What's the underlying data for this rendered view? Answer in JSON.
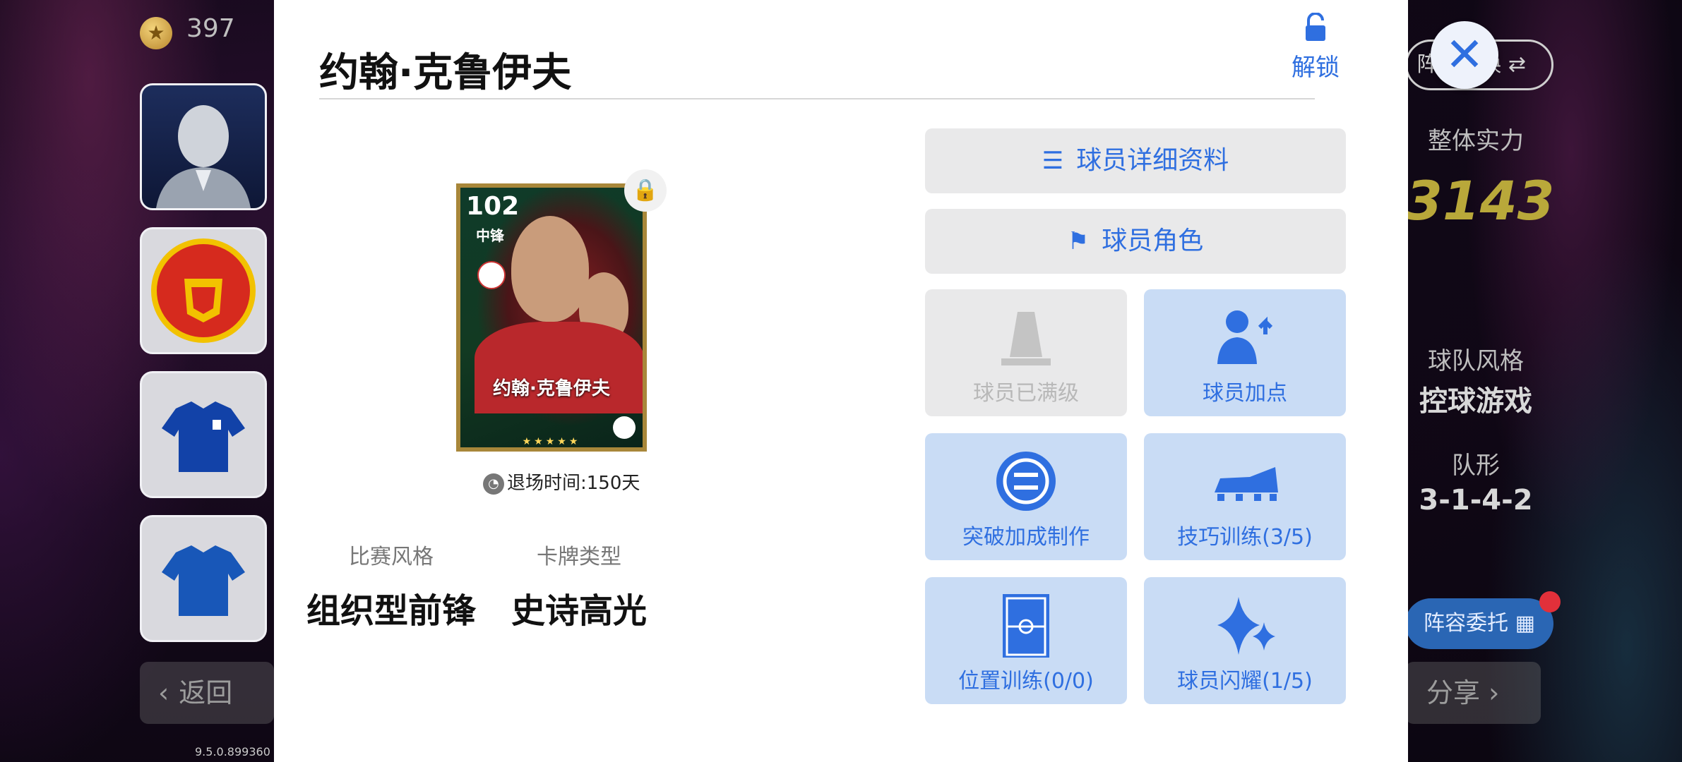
{
  "background": {
    "coins": "397",
    "back_label": "返回",
    "version": "9.5.0.899360",
    "switch_label": "阵型切换",
    "overall_label": "整体实力",
    "overall_value": "3143",
    "style_label": "球队风格",
    "style_value": "控球游戏",
    "formation_label": "队形",
    "formation_value": "3-1-4-2",
    "delegate_label": "阵容委托",
    "share_label": "分享"
  },
  "modal": {
    "title": "约翰·克鲁伊夫",
    "unlock_label": "解锁",
    "card": {
      "rating": "102",
      "position": "中锋",
      "name": "约翰·克鲁伊夫",
      "stars": "★★★★★"
    },
    "exit_time": "退场时间:150天",
    "play_style_label": "比赛风格",
    "play_style_value": "组织型前锋",
    "card_type_label": "卡牌类型",
    "card_type_value": "史诗高光",
    "buttons": {
      "details": "球员详细资料",
      "role": "球员角色",
      "maxed": "球员已满级",
      "add_points": "球员加点",
      "breakthrough": "突破加成制作",
      "skill_training": "技巧训练(3/5)",
      "position_training": "位置训练(0/0)",
      "shine": "球员闪耀(1/5)"
    }
  }
}
